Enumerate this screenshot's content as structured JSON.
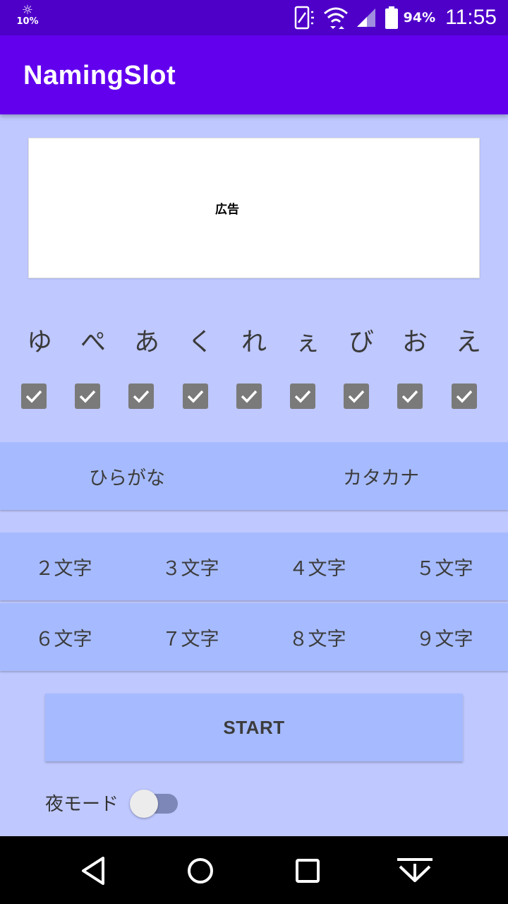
{
  "status_bar": {
    "brightness_pct": "10%",
    "battery_pct": "94%",
    "time": "11:55",
    "icons": [
      "brightness-icon",
      "vibrate-icon",
      "wifi-icon",
      "signal-icon",
      "battery-icon"
    ]
  },
  "app_bar": {
    "title": "NamingSlot"
  },
  "ad": {
    "label": "広告"
  },
  "kana": [
    "ゆ",
    "ぺ",
    "あ",
    "く",
    "れ",
    "ぇ",
    "び",
    "お",
    "え"
  ],
  "checkboxes": [
    true,
    true,
    true,
    true,
    true,
    true,
    true,
    true,
    true
  ],
  "script_type": {
    "hiragana": "ひらがな",
    "katakana": "カタカナ"
  },
  "length_buttons": {
    "row1": [
      "２文字",
      "３文字",
      "４文字",
      "５文字"
    ],
    "row2": [
      "６文字",
      "７文字",
      "８文字",
      "９文字"
    ]
  },
  "start": {
    "label": "START"
  },
  "night_mode": {
    "label": "夜モード",
    "enabled": false
  },
  "colors": {
    "status_bar": "#4e00c9",
    "app_bar": "#6200ee",
    "background": "#bfc8ff",
    "button": "#a6bbff",
    "checkbox": "#7a7a7a"
  }
}
